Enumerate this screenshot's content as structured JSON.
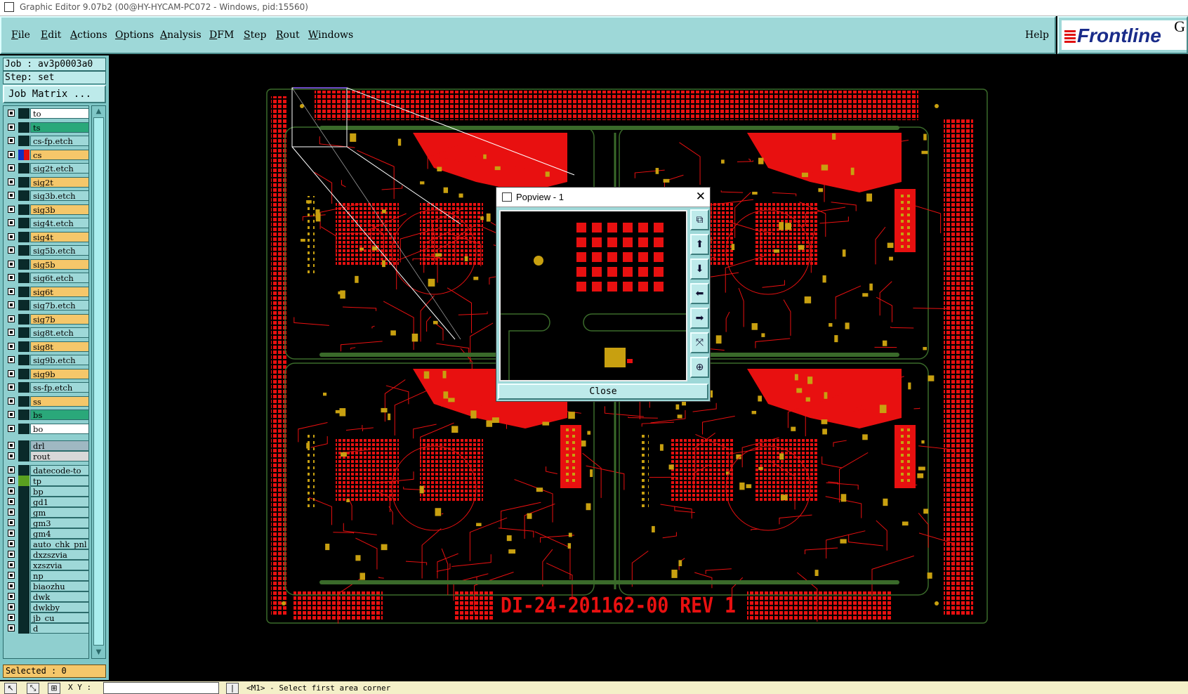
{
  "window": {
    "title": "Graphic Editor 9.07b2 (00@HY-HYCAM-PC072 - Windows, pid:15560)"
  },
  "menu": {
    "items": [
      "File",
      "Edit",
      "Actions",
      "Options",
      "Analysis",
      "DFM",
      "Step",
      "Rout",
      "Windows"
    ],
    "help": "Help"
  },
  "logo": {
    "text": "Frontline",
    "corner": "G"
  },
  "job": {
    "label": "Job : av3p0003a0",
    "step": "Step: set",
    "matrix_button": "Job Matrix ..."
  },
  "layers": [
    {
      "name": "to",
      "color": "#ffffff",
      "swatch": "#0a2a2a"
    },
    {
      "name": "ts",
      "color": "#2aa87a",
      "swatch": "#0a2a2a"
    },
    {
      "name": "cs-fp.etch",
      "color": "#9ed8d8",
      "swatch": "#0a2a2a"
    },
    {
      "name": "cs",
      "color": "#f5c76a",
      "swatch": "#e01010",
      "active": true
    },
    {
      "name": "sig2t.etch",
      "color": "#9ed8d8",
      "swatch": "#0a2a2a"
    },
    {
      "name": "sig2t",
      "color": "#f5c76a",
      "swatch": "#0a2a2a"
    },
    {
      "name": "sig3b.etch",
      "color": "#9ed8d8",
      "swatch": "#0a2a2a"
    },
    {
      "name": "sig3b",
      "color": "#f5c76a",
      "swatch": "#0a2a2a"
    },
    {
      "name": "sig4t.etch",
      "color": "#9ed8d8",
      "swatch": "#0a2a2a"
    },
    {
      "name": "sig4t",
      "color": "#f5c76a",
      "swatch": "#0a2a2a"
    },
    {
      "name": "sig5b.etch",
      "color": "#9ed8d8",
      "swatch": "#0a2a2a"
    },
    {
      "name": "sig5b",
      "color": "#f5c76a",
      "swatch": "#0a2a2a"
    },
    {
      "name": "sig6t.etch",
      "color": "#9ed8d8",
      "swatch": "#0a2a2a"
    },
    {
      "name": "sig6t",
      "color": "#f5c76a",
      "swatch": "#0a2a2a"
    },
    {
      "name": "sig7b.etch",
      "color": "#9ed8d8",
      "swatch": "#0a2a2a"
    },
    {
      "name": "sig7b",
      "color": "#f5c76a",
      "swatch": "#0a2a2a"
    },
    {
      "name": "sig8t.etch",
      "color": "#9ed8d8",
      "swatch": "#0a2a2a"
    },
    {
      "name": "sig8t",
      "color": "#f5c76a",
      "swatch": "#0a2a2a"
    },
    {
      "name": "sig9b.etch",
      "color": "#9ed8d8",
      "swatch": "#0a2a2a"
    },
    {
      "name": "sig9b",
      "color": "#f5c76a",
      "swatch": "#0a2a2a"
    },
    {
      "name": "ss-fp.etch",
      "color": "#9ed8d8",
      "swatch": "#0a2a2a"
    },
    {
      "name": "ss",
      "color": "#f5c76a",
      "swatch": "#0a2a2a"
    },
    {
      "name": "bs",
      "color": "#2aa87a",
      "swatch": "#0a2a2a"
    },
    {
      "name": "bo",
      "color": "#ffffff",
      "swatch": "#0a2a2a"
    },
    {
      "name": "drl",
      "color": "#9fb8c2",
      "swatch": "#0a2a2a",
      "gap": true
    },
    {
      "name": "rout",
      "color": "#d8d8d8",
      "swatch": "#0a2a2a"
    },
    {
      "name": "datecode-to",
      "color": "#9ed8d8",
      "swatch": "#0a2a2a",
      "gap": true
    },
    {
      "name": "tp",
      "color": "#9ed8d8",
      "swatch": "#5aa020"
    },
    {
      "name": "bp",
      "color": "#9ed8d8",
      "swatch": "#0a2a2a"
    },
    {
      "name": "gd1",
      "color": "#9ed8d8",
      "swatch": "#0a2a2a"
    },
    {
      "name": "gm",
      "color": "#9ed8d8",
      "swatch": "#0a2a2a"
    },
    {
      "name": "gm3",
      "color": "#9ed8d8",
      "swatch": "#0a2a2a"
    },
    {
      "name": "gm4",
      "color": "#9ed8d8",
      "swatch": "#0a2a2a"
    },
    {
      "name": "auto_chk_pnl",
      "color": "#9ed8d8",
      "swatch": "#0a2a2a"
    },
    {
      "name": "dxzszvia",
      "color": "#9ed8d8",
      "swatch": "#0a2a2a"
    },
    {
      "name": "xzszvia",
      "color": "#9ed8d8",
      "swatch": "#0a2a2a"
    },
    {
      "name": "np",
      "color": "#9ed8d8",
      "swatch": "#0a2a2a"
    },
    {
      "name": "biaozhu",
      "color": "#9ed8d8",
      "swatch": "#0a2a2a"
    },
    {
      "name": "dwk",
      "color": "#9ed8d8",
      "swatch": "#0a2a2a"
    },
    {
      "name": "dwkby",
      "color": "#9ed8d8",
      "swatch": "#0a2a2a"
    },
    {
      "name": "jb_cu",
      "color": "#9ed8d8",
      "swatch": "#0a2a2a"
    },
    {
      "name": "d",
      "color": "#9ed8d8",
      "swatch": "#0a2a2a"
    }
  ],
  "selected": "Selected : 0",
  "board": {
    "label": "DI-24-201162-00 REV 1"
  },
  "popview": {
    "title": "Popview - 1",
    "close_label": "Close"
  },
  "statusbar": {
    "xy_label": "X Y :",
    "xy_value": "",
    "message": "<M1> - Select first area corner"
  },
  "colors": {
    "trace": "#e81010",
    "pad": "#c8a010",
    "outline": "#3a6a2a",
    "panel": "#9ed8d8"
  }
}
